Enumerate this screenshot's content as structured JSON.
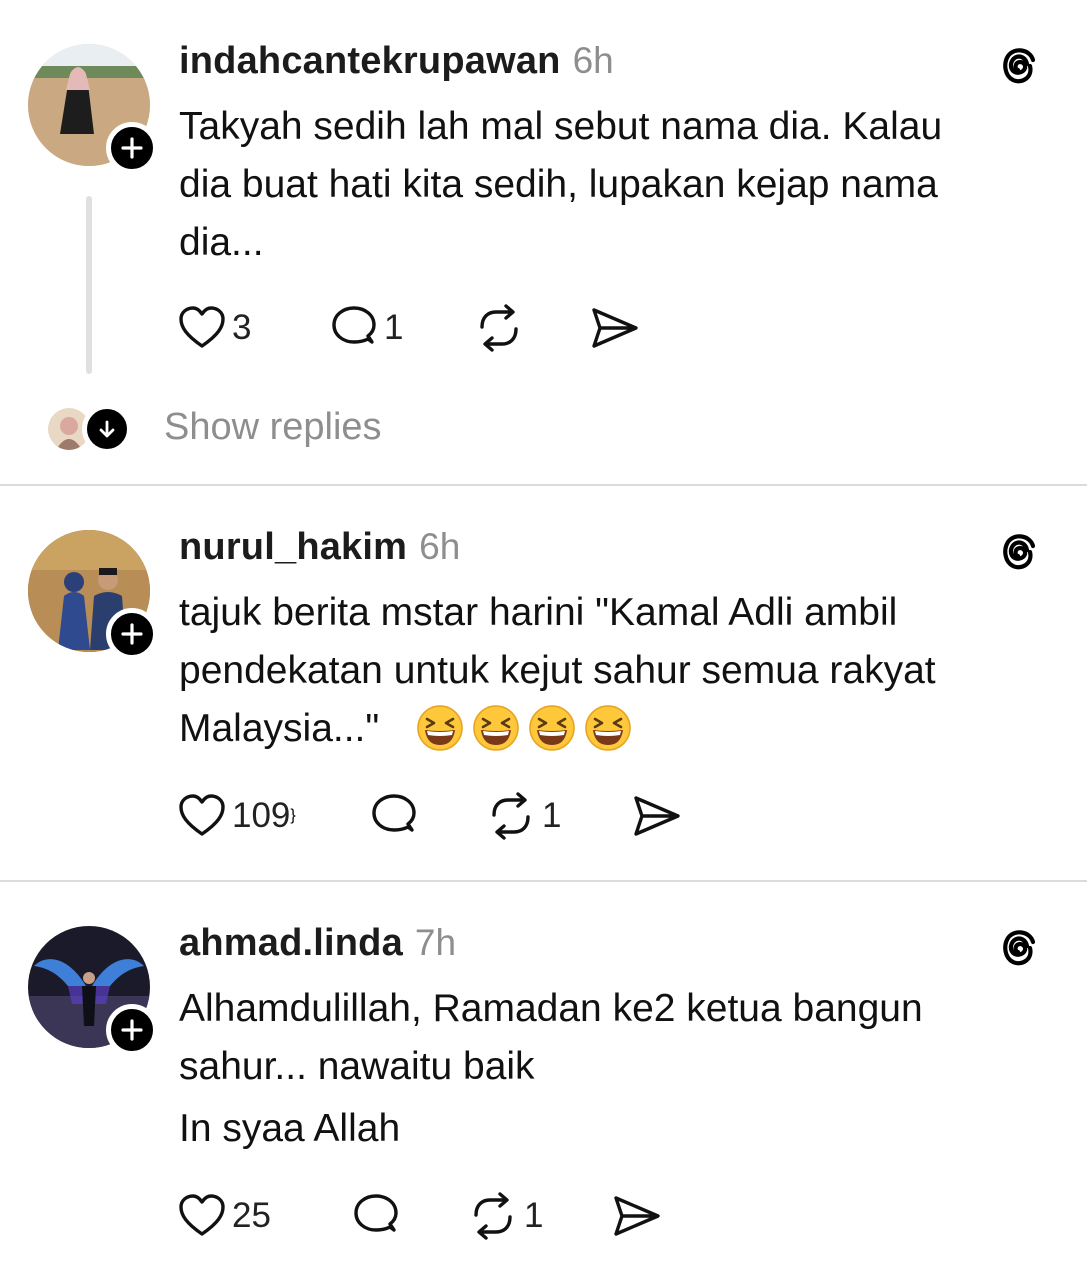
{
  "posts": [
    {
      "username": "indahcantekrupawan",
      "time": "6h",
      "text": [
        "Takyah sedih lah mal sebut nama dia. Kalau",
        "dia buat hati kita sedih, lupakan kejap nama",
        "dia..."
      ],
      "likes": "3",
      "replies": "1",
      "reposts": "",
      "show_replies": "Show replies"
    },
    {
      "username": "nurul_hakim",
      "time": "6h",
      "text": [
        "tajuk berita mstar harini \"Kamal Adli ambil",
        "pendekatan untuk kejut sahur semua rakyat",
        "Malaysia...\""
      ],
      "emoji": [
        "grinning-squinting-face",
        "grinning-squinting-face",
        "grinning-squinting-face",
        "grinning-squinting-face"
      ],
      "likes": "109",
      "replies": "",
      "reposts": "1"
    },
    {
      "username": "ahmad.linda",
      "time": "7h",
      "text": [
        "Alhamdulillah, Ramadan ke2 ketua bangun",
        "sahur... nawaitu baik",
        "In syaa Allah"
      ],
      "likes": "25",
      "replies": "",
      "reposts": "1"
    }
  ],
  "icons": {
    "like": "heart-outline-icon",
    "reply": "speech-bubble-icon",
    "repost": "repost-arrows-icon",
    "share": "send-icon",
    "brand": "threads-logo-icon",
    "follow": "plus-icon",
    "expand": "arrow-down-icon"
  },
  "colors": {
    "text": "#111111",
    "muted": "#8e8e8e",
    "divider": "#dbdbdb",
    "badge": "#000000"
  }
}
